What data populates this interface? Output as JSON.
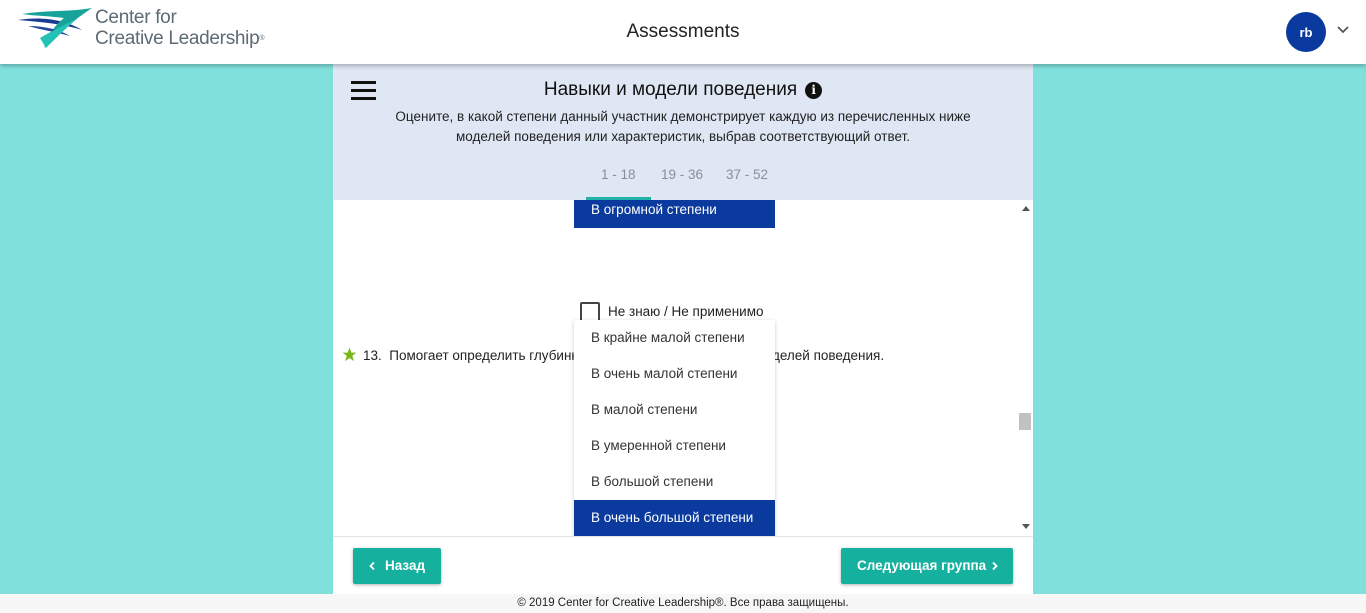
{
  "header": {
    "logo_line1": "Center for",
    "logo_line2": "Creative Leadership",
    "logo_mark": "®",
    "title": "Assessments",
    "user_initials": "rb"
  },
  "section": {
    "title": "Навыки и модели поведения",
    "instructions": "Оцените, в какой степени данный участник демонстрирует каждую из перечисленных ниже моделей поведения или характеристик, выбрав соответствующий ответ.",
    "tabs": [
      {
        "label": "1 - 18",
        "active": true
      },
      {
        "label": "19 - 36",
        "active": false
      },
      {
        "label": "37 - 52",
        "active": false
      }
    ]
  },
  "previous_question": {
    "selected_answer": "В огромной степени",
    "not_applicable_label": "Не знаю / Не применимо",
    "not_applicable_checked": false
  },
  "question": {
    "number": "13.",
    "text": "Помогает определить глубинные причины существующих моделей поведения.",
    "options": [
      {
        "label": "В крайне малой степени",
        "selected": false
      },
      {
        "label": "В очень малой степени",
        "selected": false
      },
      {
        "label": "В малой степени",
        "selected": false
      },
      {
        "label": "В умеренной степени",
        "selected": false
      },
      {
        "label": "В большой степени",
        "selected": false
      },
      {
        "label": "В очень большой степени",
        "selected": true
      }
    ]
  },
  "navigation": {
    "back_label": "Назад",
    "next_label": "Следующая группа"
  },
  "footer": {
    "copyright": "© 2019 Center for Creative Leadership®. Все права защищены."
  },
  "colors": {
    "background": "#80e0dc",
    "primary_blue": "#0a3a9e",
    "teal_button": "#15b09e",
    "header_panel": "#dfe7f4",
    "star_green": "#7ab61b"
  },
  "icons": {
    "menu": "hamburger-icon",
    "info": "info-icon",
    "required": "star-icon",
    "back": "chevron-left-icon",
    "next": "chevron-right-icon",
    "account": "chevron-down-icon"
  }
}
